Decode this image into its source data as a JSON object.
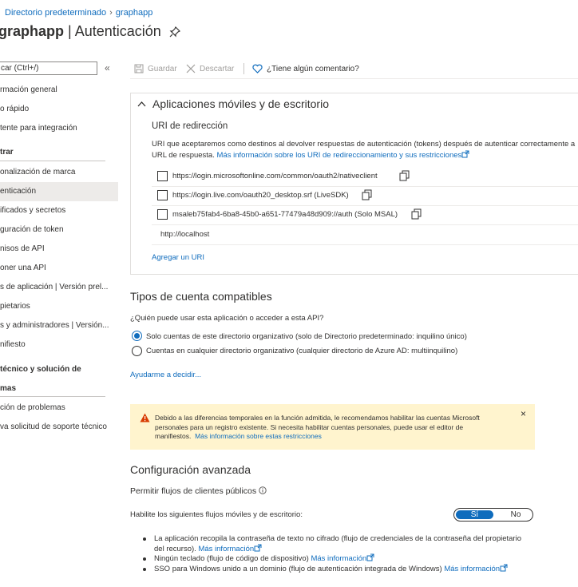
{
  "breadcrumb": {
    "item1": "Directorio predeterminado",
    "item2": "graphapp"
  },
  "title": {
    "app": "graphapp",
    "separator": " | ",
    "page": "Autenticación"
  },
  "sidebar": {
    "search_text": "car (Ctrl+/)",
    "items": [
      "rmación general",
      "o rápido",
      "tente para integración",
      "trar",
      "onalización de marca",
      "enticación",
      "ificados y secretos",
      "guración de token",
      "nisos de API",
      "oner una API",
      "s de aplicación | Versión prel...",
      "pietarios",
      "s y administradores | Versión...",
      "nifiesto",
      "técnico y solución de",
      "mas",
      "ción de problemas",
      "va solicitud de soporte técnico"
    ]
  },
  "toolbar": {
    "save": "Guardar",
    "discard": "Descartar",
    "feedback": "¿Tiene algún comentario?"
  },
  "mobile": {
    "heading": "Aplicaciones móviles y de escritorio",
    "redirect_title": "URI de redirección",
    "desc_line1": "URI que aceptaremos como destinos al devolver respuestas de autenticación (tokens) después de autenticar correctamente a",
    "desc_line2": "URL de respuesta.",
    "desc_link": "Más información sobre los URI de redireccionamiento y sus restricciones",
    "uris": [
      "https://login.microsoftonline.com/common/oauth2/nativeclient",
      "https://login.live.com/oauth20_desktop.srf (LiveSDK)",
      "msaleb75fab4-6ba8-45b0-a651-77479a48d909://auth (Solo MSAL)"
    ],
    "custom_uri": "http://localhost",
    "add_uri": "Agregar un URI"
  },
  "accounts": {
    "heading": "Tipos de cuenta compatibles",
    "question": "¿Quién puede usar esta aplicación o acceder a esta API?",
    "option1": "Solo cuentas de este directorio organizativo (solo de Directorio predeterminado: inquilino único)",
    "option2": "Cuentas en cualquier directorio organizativo (cualquier directorio de Azure AD: multiinquilino)",
    "help_link": "Ayudarme a decidir..."
  },
  "banner": {
    "line1": "Debido a las diferencias temporales en la función admitida, le recomendamos habilitar las cuentas Microsoft",
    "line2": "personales para un registro existente. Si necesita habilitar cuentas personales, puede usar el editor de",
    "line3": "manifiestos.",
    "link": "Más información sobre estas restricciones",
    "close": "×"
  },
  "advanced": {
    "heading": "Configuración avanzada",
    "public_flows": "Permitir flujos de clientes públicos",
    "enable_label": "Habilite los siguientes flujos móviles y de escritorio:",
    "toggle_on": "Sí",
    "toggle_off": "No",
    "bullet1_line1": "La aplicación recopila la contraseña de texto no cifrado (flujo de credenciales de la contraseña del propietario",
    "bullet1_line2": "del recurso).",
    "bullet2": "Ningún teclado (flujo de código de dispositivo)",
    "bullet3": "SSO para Windows unido a un dominio (flujo de autenticación integrada de Windows)",
    "more_info": "Más información"
  },
  "colors": {
    "accent": "#0f6cbd",
    "warning_bg": "#fff4ce",
    "warning_icon": "#d83b01",
    "selected_nav": "#edebe9"
  }
}
